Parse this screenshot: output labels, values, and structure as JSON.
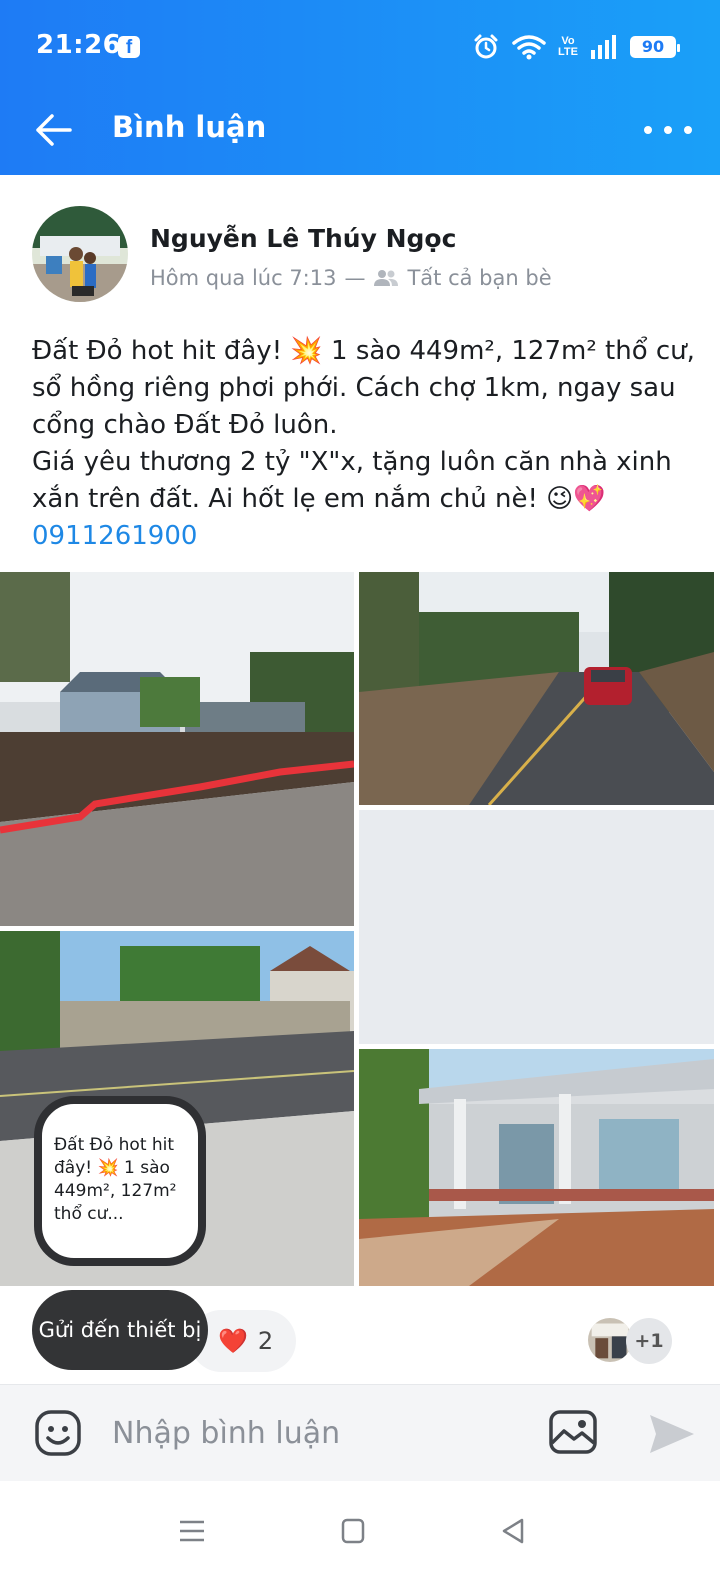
{
  "status_bar": {
    "time": "21:26",
    "app_badge": "f",
    "volte_line1": "Vo",
    "volte_line2": "LTE",
    "battery": "90"
  },
  "header": {
    "title": "Bình luận"
  },
  "post": {
    "author": "Nguyễn Lê Thúy Ngọc",
    "time": "Hôm qua lúc 7:13",
    "separator": "—",
    "audience": "Tất cả bạn bè",
    "text_line1": "Đất Đỏ hot hit đây! 💥 1 sào 449m², 127m² thổ cư, sổ hồng riêng phơi phới. Cách chợ 1km, ngay sau cổng chào Đất Đỏ luôn.",
    "text_line2": "Giá yêu thương 2 tỷ \"X\"x, tặng luôn căn nhà xinh xắn trên đất. Ai hốt lẹ em nắm chủ nè! 😉💖",
    "phone": "0911261900"
  },
  "bubble": {
    "text": "Đất Đỏ hot hit đây! 💥 1 sào 449m², 127m² thổ cư..."
  },
  "reactions": {
    "send_to_device": "Gửi đến thiết bị",
    "heart": "❤️",
    "count": "2",
    "viewers_more": "+1"
  },
  "comment": {
    "placeholder": "Nhập bình luận"
  },
  "colors": {
    "header_start": "#1e7bf5",
    "header_end": "#1aa0f8",
    "link": "#1e88e5"
  },
  "icons": [
    "back-arrow-icon",
    "more-icon",
    "friends-icon",
    "emoji-icon",
    "image-icon",
    "send-icon",
    "alarm-icon",
    "wifi-icon",
    "signal-icon"
  ]
}
